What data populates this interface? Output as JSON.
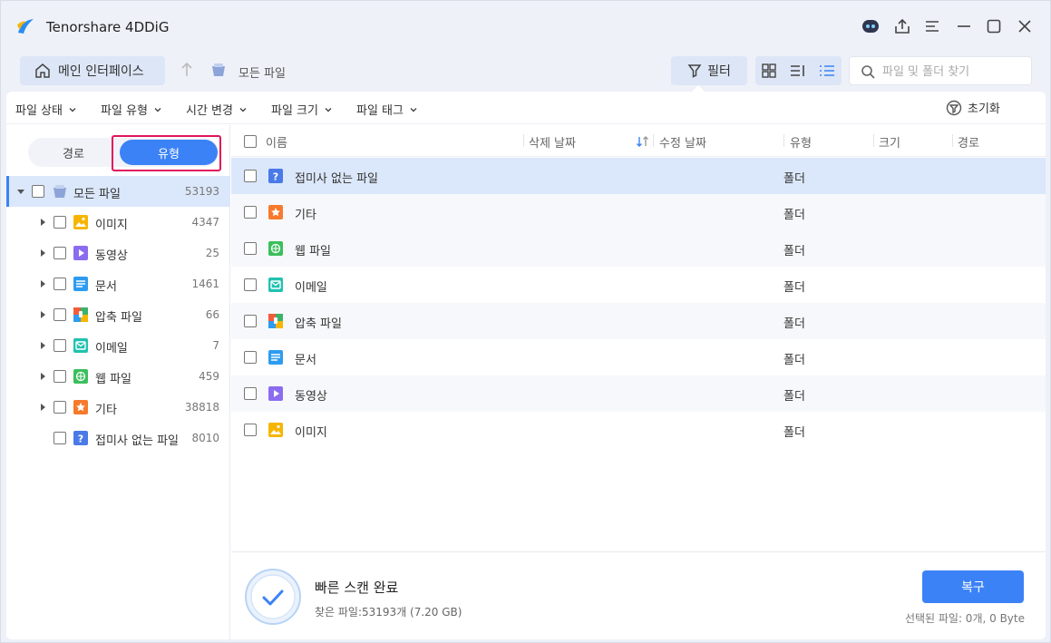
{
  "app": {
    "title": "Tenorshare 4DDiG"
  },
  "nav": {
    "home_label": "메인 인터페이스",
    "breadcrumb": "모든 파일"
  },
  "toolbar": {
    "filter_label": "필터",
    "search_placeholder": "파일 및 폴더 찾기"
  },
  "filters": {
    "items": [
      "파일 상태",
      "파일 유형",
      "시간 변경",
      "파일 크기",
      "파일 태그"
    ],
    "reset_label": "초기화"
  },
  "sidebar": {
    "tab_path": "경로",
    "tab_type": "유형",
    "root": {
      "label": "모든 파일",
      "count": "53193"
    },
    "items": [
      {
        "label": "이미지",
        "count": "4347",
        "icon": "image-icon"
      },
      {
        "label": "동영상",
        "count": "25",
        "icon": "video-icon"
      },
      {
        "label": "문서",
        "count": "1461",
        "icon": "document-icon"
      },
      {
        "label": "압축 파일",
        "count": "66",
        "icon": "archive-icon"
      },
      {
        "label": "이메일",
        "count": "7",
        "icon": "email-icon"
      },
      {
        "label": "웹 파일",
        "count": "459",
        "icon": "web-icon"
      },
      {
        "label": "기타",
        "count": "38818",
        "icon": "other-icon"
      },
      {
        "label": "접미사 없는 파일",
        "count": "8010",
        "icon": "unknown-icon"
      }
    ]
  },
  "table": {
    "columns": [
      "이름",
      "삭제 날짜",
      "수정 날짜",
      "유형",
      "크기",
      "경로"
    ],
    "rows": [
      {
        "name": "접미사 없는 파일",
        "type": "폴더",
        "icon": "unknown-icon"
      },
      {
        "name": "기타",
        "type": "폴더",
        "icon": "other-icon"
      },
      {
        "name": "웹 파일",
        "type": "폴더",
        "icon": "web-icon"
      },
      {
        "name": "이메일",
        "type": "폴더",
        "icon": "email-icon"
      },
      {
        "name": "압축 파일",
        "type": "폴더",
        "icon": "archive-icon"
      },
      {
        "name": "문서",
        "type": "폴더",
        "icon": "document-icon"
      },
      {
        "name": "동영상",
        "type": "폴더",
        "icon": "video-icon"
      },
      {
        "name": "이미지",
        "type": "폴더",
        "icon": "image-icon"
      }
    ]
  },
  "footer": {
    "scan_title": "빠른 스캔 완료",
    "scan_sub": "찾은 파일:53193개 (7.20 GB)",
    "recover_label": "복구",
    "selected_info": "선택된 파일: 0개, 0 Byte"
  },
  "colors": {
    "accent": "#3b82f6",
    "highlight": "#e0145c",
    "selected_row": "#dbe7fa"
  }
}
